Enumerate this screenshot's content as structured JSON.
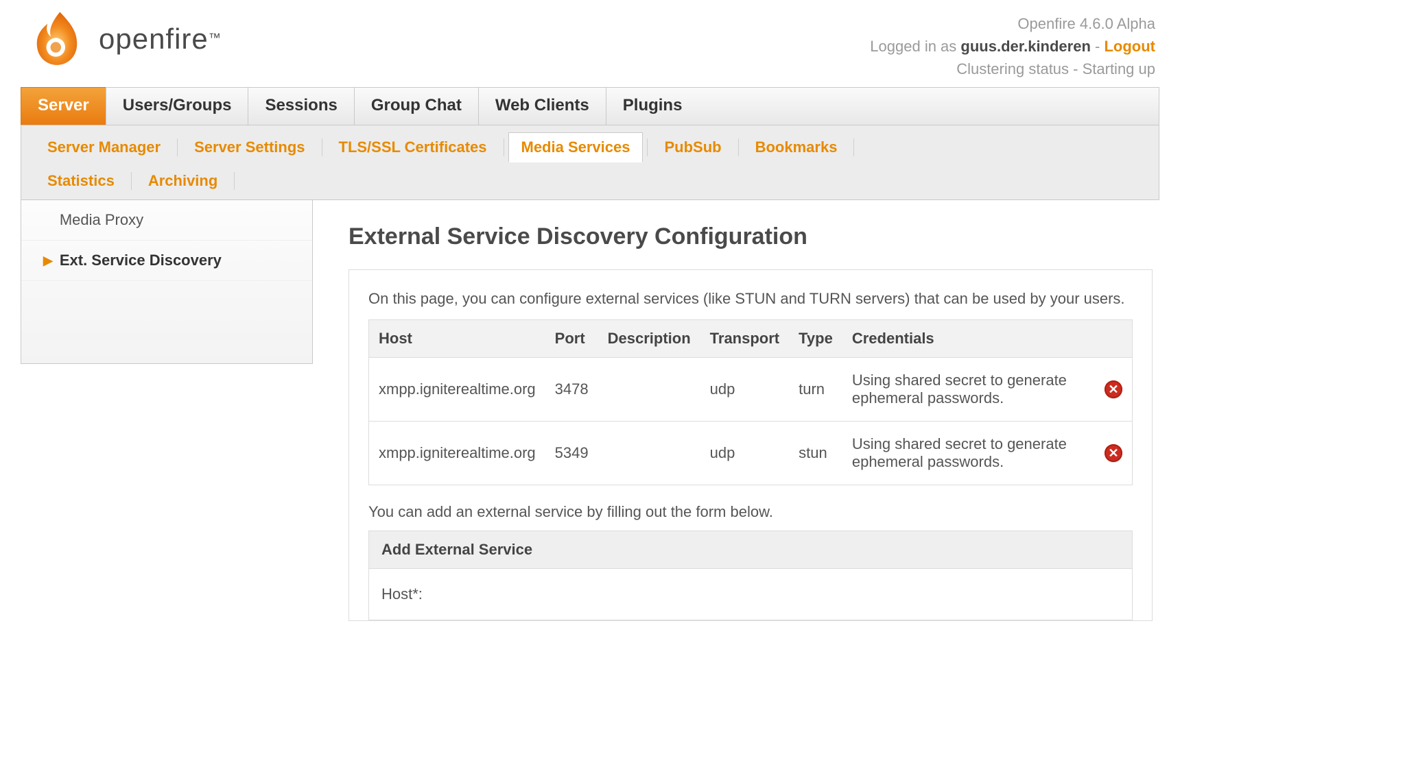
{
  "brand": {
    "name": "openfire",
    "tm": "™"
  },
  "header": {
    "version": "Openfire 4.6.0 Alpha",
    "logged_in_prefix": "Logged in as ",
    "username": "guus.der.kinderen",
    "sep": " - ",
    "logout": "Logout",
    "cluster_label": "Clustering status - ",
    "cluster_state": "Starting up"
  },
  "tabs": {
    "items": [
      {
        "label": "Server",
        "active": true
      },
      {
        "label": "Users/Groups",
        "active": false
      },
      {
        "label": "Sessions",
        "active": false
      },
      {
        "label": "Group Chat",
        "active": false
      },
      {
        "label": "Web Clients",
        "active": false
      },
      {
        "label": "Plugins",
        "active": false
      }
    ]
  },
  "subnav": {
    "items": [
      {
        "label": "Server Manager",
        "active": false
      },
      {
        "label": "Server Settings",
        "active": false
      },
      {
        "label": "TLS/SSL Certificates",
        "active": false
      },
      {
        "label": "Media Services",
        "active": true
      },
      {
        "label": "PubSub",
        "active": false
      },
      {
        "label": "Bookmarks",
        "active": false
      },
      {
        "label": "Statistics",
        "active": false
      },
      {
        "label": "Archiving",
        "active": false
      }
    ]
  },
  "sidebar": {
    "items": [
      {
        "label": "Media Proxy",
        "active": false
      },
      {
        "label": "Ext. Service Discovery",
        "active": true
      }
    ]
  },
  "page": {
    "title": "External Service Discovery Configuration",
    "intro": "On this page, you can configure external services (like STUN and TURN servers) that can be used by your users.",
    "note": "You can add an external service by filling out the form below.",
    "form_header": "Add External Service",
    "form_host_label": "Host*:"
  },
  "table": {
    "headers": {
      "host": "Host",
      "port": "Port",
      "description": "Description",
      "transport": "Transport",
      "type": "Type",
      "credentials": "Credentials"
    },
    "rows": [
      {
        "host": "xmpp.igniterealtime.org",
        "port": "3478",
        "description": "",
        "transport": "udp",
        "type": "turn",
        "credentials": "Using shared secret to generate ephemeral passwords."
      },
      {
        "host": "xmpp.igniterealtime.org",
        "port": "5349",
        "description": "",
        "transport": "udp",
        "type": "stun",
        "credentials": "Using shared secret to generate ephemeral passwords."
      }
    ]
  }
}
